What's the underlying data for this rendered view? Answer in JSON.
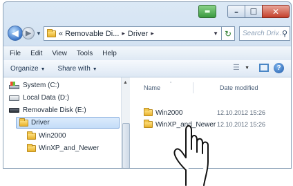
{
  "window": {
    "address": {
      "segments": [
        "Removable Di...",
        "Driver"
      ],
      "prefix": "«"
    },
    "search_placeholder": "Search Driv..."
  },
  "menubar": [
    "File",
    "Edit",
    "View",
    "Tools",
    "Help"
  ],
  "toolbar": {
    "organize": "Organize",
    "share_with": "Share with"
  },
  "navigation_pane": [
    {
      "label": "System (C:)",
      "icon": "system-drive-icon"
    },
    {
      "label": "Local Data (D:)",
      "icon": "drive-icon"
    },
    {
      "label": "Removable Disk (E:)",
      "icon": "removable-drive-icon"
    },
    {
      "label": "Driver",
      "icon": "folder-icon",
      "selected": true
    },
    {
      "label": "Win2000",
      "icon": "folder-icon"
    },
    {
      "label": "WinXP_and_Newer",
      "icon": "folder-icon"
    }
  ],
  "columns": {
    "name": "Name",
    "date_modified": "Date modified"
  },
  "files": [
    {
      "name": "Win2000",
      "date": "12.10.2012 15:26"
    },
    {
      "name": "WinXP_and_Newer",
      "date": "12.10.2012 15:26"
    }
  ],
  "colors": {
    "window_frame": "#c9dbee",
    "close_button": "#c4402b",
    "folder": "#e7b12a",
    "selection": "#c4ddf8"
  }
}
